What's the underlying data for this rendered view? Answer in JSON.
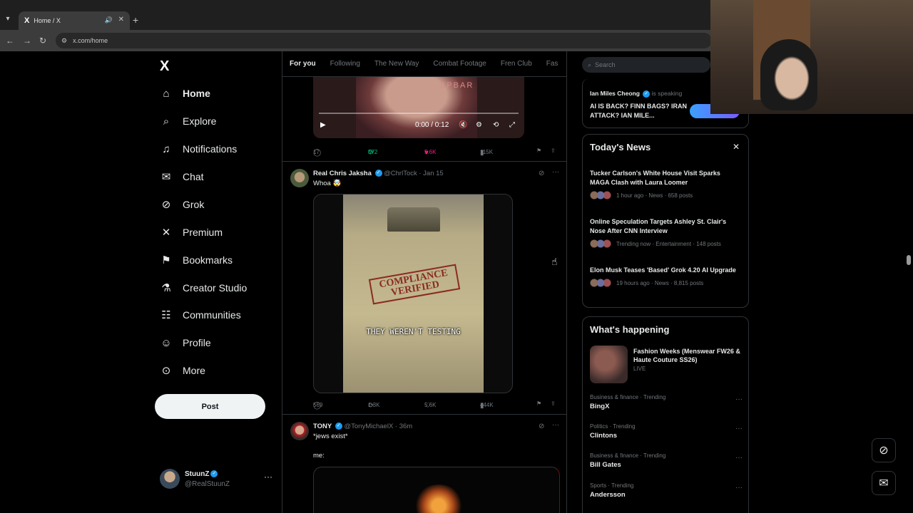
{
  "browser": {
    "tab_title": "Home / X",
    "tab_favicon": "X",
    "url": "x.com/home",
    "new_tab": "+",
    "close": "✕"
  },
  "nav": {
    "logo": "X",
    "items": [
      {
        "label": "Home",
        "icon": "home-icon",
        "glyph": "⌂"
      },
      {
        "label": "Explore",
        "icon": "search-icon",
        "glyph": "⌕"
      },
      {
        "label": "Notifications",
        "icon": "bell-icon",
        "glyph": "♫"
      },
      {
        "label": "Chat",
        "icon": "mail-icon",
        "glyph": "✉"
      },
      {
        "label": "Grok",
        "icon": "grok-icon",
        "glyph": "⊘"
      },
      {
        "label": "Premium",
        "icon": "x-icon",
        "glyph": "✕"
      },
      {
        "label": "Bookmarks",
        "icon": "bookmark-icon",
        "glyph": "⚑"
      },
      {
        "label": "Creator Studio",
        "icon": "flask-icon",
        "glyph": "⚗"
      },
      {
        "label": "Communities",
        "icon": "people-icon",
        "glyph": "☷"
      },
      {
        "label": "Profile",
        "icon": "person-icon",
        "glyph": "☺"
      },
      {
        "label": "More",
        "icon": "more-circle-icon",
        "glyph": "⊙"
      }
    ],
    "post_label": "Post",
    "account": {
      "name": "StuunZ",
      "handle": "@RealStuunZ",
      "dots": "···"
    }
  },
  "timeline": {
    "tabs": [
      "For you",
      "Following",
      "The New Way",
      "Combat Footage",
      "Fren Club",
      "Fas"
    ],
    "tweet1": {
      "video_time": "0:00 / 0:12",
      "video_text": "SPBAR",
      "replies": "17",
      "reposts": "572",
      "likes": "5.6K",
      "views": "115K"
    },
    "tweet2": {
      "name": "Real Chris Jaksha",
      "handle": "@ChrlTock · Jan 15",
      "text": "Whoa 🤯",
      "stamp": "COMPLIANCE VERIFIED",
      "caption": "THEY WEREN'T TESTING",
      "replies": "569",
      "reposts": "1.3K",
      "likes": "5.6K",
      "views": "444K"
    },
    "tweet3": {
      "name": "TONY",
      "handle": "@TonyMichaelX · 36m",
      "text": "*jews exist*",
      "text2": "me:"
    }
  },
  "right": {
    "search_placeholder": "Search",
    "space": {
      "host": "Ian Miles Cheong",
      "speaking": "is speaking",
      "title": "AI IS BACK? FINN BAGS? IRAN ATTACK? IAN MILE..."
    },
    "news": {
      "title": "Today's News",
      "close": "✕",
      "items": [
        {
          "headline": "Tucker Carlson's White House Visit Sparks MAGA Clash with Laura Loomer",
          "meta": "1 hour ago · News · 658 posts"
        },
        {
          "headline": "Online Speculation Targets Ashley St. Clair's Nose After CNN Interview",
          "meta": "Trending now · Entertainment · 148 posts"
        },
        {
          "headline": "Elon Musk Teases 'Based' Grok 4.20 AI Upgrade",
          "meta": "19 hours ago · News · 8,815 posts"
        }
      ]
    },
    "happening": {
      "title": "What's happening",
      "feature": {
        "headline": "Fashion Weeks (Menswear FW26 & Haute Couture SS26)",
        "status": "LIVE"
      },
      "trends": [
        {
          "category": "Business & finance · Trending",
          "name": "BingX"
        },
        {
          "category": "Politics · Trending",
          "name": "Clintons"
        },
        {
          "category": "Business & finance · Trending",
          "name": "Bill Gates"
        },
        {
          "category": "Sports · Trending",
          "name": "Andersson"
        }
      ]
    }
  },
  "colors": {
    "accent": "#1d9bf0",
    "like": "#f91880",
    "repost": "#00ba7c",
    "background": "#000000"
  }
}
